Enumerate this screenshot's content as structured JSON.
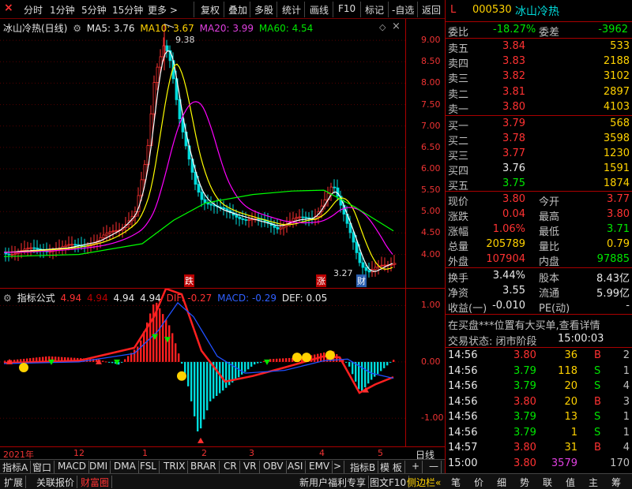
{
  "toolbar": {
    "close": "×",
    "items": [
      "分时",
      "1分钟",
      "5分钟",
      "15分钟",
      "更多 >",
      "复权",
      "叠加",
      "多股",
      "统计",
      "画线",
      "F10",
      "标记",
      "-自选",
      "返回"
    ]
  },
  "main_legend": {
    "title": "冰山冷热(日线)",
    "ma5": "MA5: 3.76",
    "ma10": "MA10: 3.67",
    "ma20": "MA20: 3.99",
    "ma60": "MA60: 4.54"
  },
  "ind_legend": {
    "title": "指标公式",
    "v1": "4.94",
    "v2": "4.94",
    "v3": "4.94",
    "v4": "4.94",
    "dif": "DIF: -0.27",
    "macd": "MACD: -0.29",
    "def": "DEF: 0.05"
  },
  "annotations": {
    "high": "9.38",
    "low": "3.27",
    "tag1": "跌",
    "tag2": "涨",
    "tag3": "财"
  },
  "x_labels": {
    "year": "2021年",
    "m12": "12",
    "m1": "1",
    "m2": "2",
    "m3": "3",
    "m4": "4",
    "m5": "5",
    "period": "日线"
  },
  "tabs_row1": [
    "指标A",
    "窗口",
    "MACD",
    "DMI",
    "DMA",
    "FSL",
    "TRIX",
    "BRAR",
    "CR",
    "VR",
    "OBV",
    "ASI",
    "EMV",
    ">",
    "指标B",
    "模 板",
    "+",
    "—"
  ],
  "tabs_row2": [
    "扩展",
    "关联报价",
    "财富圈",
    "新用户福利专享",
    "图文F10",
    "侧边栏"
  ],
  "stock": {
    "flag": "L",
    "code": "000530",
    "name": "冰山冷热"
  },
  "quote": {
    "weibi_label": "委比",
    "weibi": "-18.27%",
    "weicha_label": "委差",
    "weicha": "-3962",
    "asks": [
      {
        "label": "卖五",
        "price": "3.84",
        "vol": "533"
      },
      {
        "label": "卖四",
        "price": "3.83",
        "vol": "2188"
      },
      {
        "label": "卖三",
        "price": "3.82",
        "vol": "3102"
      },
      {
        "label": "卖二",
        "price": "3.81",
        "vol": "2897"
      },
      {
        "label": "卖一",
        "price": "3.80",
        "vol": "4103"
      }
    ],
    "bids": [
      {
        "label": "买一",
        "price": "3.79",
        "vol": "568"
      },
      {
        "label": "买二",
        "price": "3.78",
        "vol": "3598"
      },
      {
        "label": "买三",
        "price": "3.77",
        "vol": "1230"
      },
      {
        "label": "买四",
        "price": "3.76",
        "vol": "1591"
      },
      {
        "label": "买五",
        "price": "3.75",
        "vol": "1874"
      }
    ],
    "stats": [
      {
        "l1": "现价",
        "v1": "3.80",
        "l2": "今开",
        "v2": "3.77"
      },
      {
        "l1": "涨跌",
        "v1": "0.04",
        "l2": "最高",
        "v2": "3.80"
      },
      {
        "l1": "涨幅",
        "v1": "1.06%",
        "l2": "最低",
        "v2": "3.71"
      },
      {
        "l1": "总量",
        "v1": "205789",
        "l2": "量比",
        "v2": "0.79"
      },
      {
        "l1": "外盘",
        "v1": "107904",
        "l2": "内盘",
        "v2": "97885"
      }
    ],
    "fund": [
      {
        "l1": "换手",
        "v1": "3.44%",
        "l2": "股本",
        "v2": "8.43亿"
      },
      {
        "l1": "净资",
        "v1": "3.55",
        "l2": "流通",
        "v2": "5.99亿"
      },
      {
        "l1": "收益(一)",
        "v1": "-0.010",
        "l2": "PE(动)",
        "v2": "-"
      }
    ],
    "notice": "在买盘***位置有大买单,查看详情",
    "status_label": "交易状态: 闭市阶段",
    "status_time": "15:00:03"
  },
  "ticks": [
    {
      "t": "14:56",
      "p": "3.80",
      "v": "36",
      "d": "B",
      "n": "2"
    },
    {
      "t": "14:56",
      "p": "3.79",
      "v": "118",
      "d": "S",
      "n": "1"
    },
    {
      "t": "14:56",
      "p": "3.79",
      "v": "20",
      "d": "S",
      "n": "4"
    },
    {
      "t": "14:56",
      "p": "3.80",
      "v": "20",
      "d": "B",
      "n": "3"
    },
    {
      "t": "14:56",
      "p": "3.79",
      "v": "13",
      "d": "S",
      "n": "1"
    },
    {
      "t": "14:56",
      "p": "3.79",
      "v": "1",
      "d": "S",
      "n": "1"
    },
    {
      "t": "14:57",
      "p": "3.80",
      "v": "31",
      "d": "B",
      "n": "4"
    },
    {
      "t": "15:00",
      "p": "3.80",
      "v": "3579",
      "d": "",
      "n": "170"
    }
  ],
  "bottom_tabs": [
    "笔",
    "价",
    "细",
    "势",
    "联",
    "值",
    "主",
    "筹"
  ],
  "chart_data": [
    {
      "type": "candlestick",
      "title": "冰山冷热(日线)",
      "y_ticks": [
        4.0,
        4.5,
        5.0,
        5.5,
        6.0,
        6.5,
        7.0,
        7.5,
        8.0,
        8.5,
        9.0
      ],
      "ylim": [
        3.2,
        9.5
      ],
      "series": [
        {
          "name": "MA5",
          "color": "#ffffff"
        },
        {
          "name": "MA10",
          "color": "#ffff00"
        },
        {
          "name": "MA20",
          "color": "#ff00ff"
        },
        {
          "name": "MA60",
          "color": "#00ff00"
        }
      ],
      "annotations": [
        {
          "label": "9.38",
          "value": 9.38
        },
        {
          "label": "3.27",
          "value": 3.27
        }
      ]
    },
    {
      "type": "bar",
      "title": "指标公式",
      "y_ticks": [
        -1.0,
        0.0,
        1.0
      ],
      "ylim": [
        -1.5,
        1.3
      ],
      "series": [
        {
          "name": "DIF",
          "color": "#ff2020"
        },
        {
          "name": "MACD",
          "color": "#2050ff"
        },
        {
          "name": "DEF",
          "color": "#ffffff"
        }
      ]
    }
  ]
}
